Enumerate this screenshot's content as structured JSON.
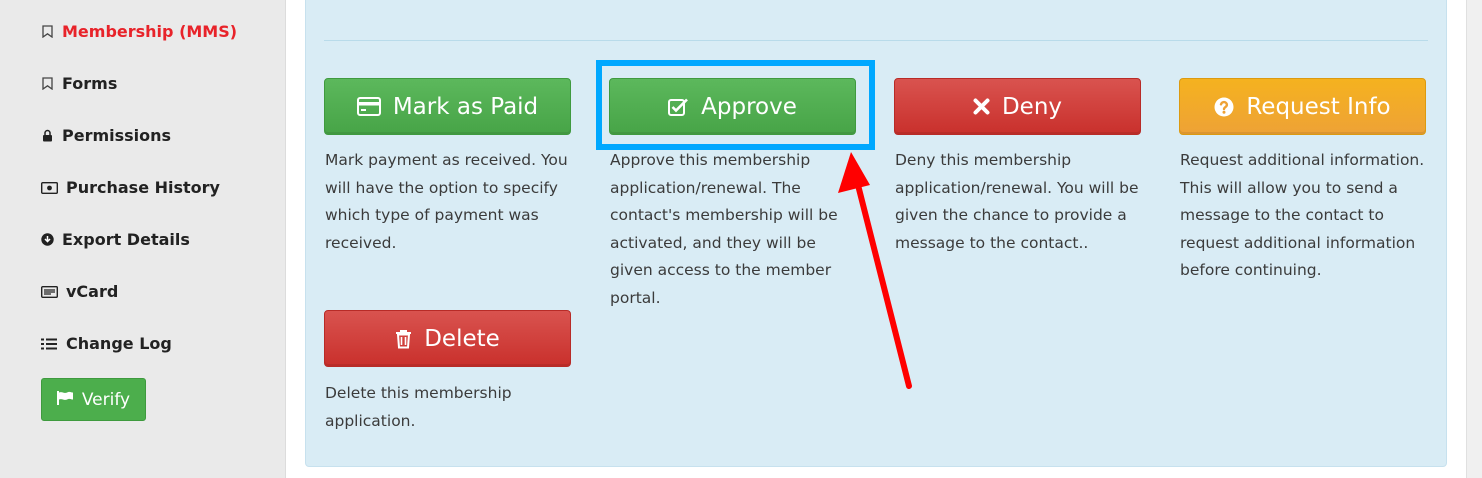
{
  "sidebar": {
    "items": [
      {
        "label": "Membership (MMS)",
        "icon": "bookmark-icon",
        "active": true
      },
      {
        "label": "Forms",
        "icon": "bookmark-icon",
        "active": false
      },
      {
        "label": "Permissions",
        "icon": "lock-icon",
        "active": false
      },
      {
        "label": "Purchase History",
        "icon": "money-icon",
        "active": false
      },
      {
        "label": "Export Details",
        "icon": "download-circle-icon",
        "active": false
      },
      {
        "label": "vCard",
        "icon": "card-icon",
        "active": false
      },
      {
        "label": "Change Log",
        "icon": "list-icon",
        "active": false
      }
    ],
    "verify_label": "Verify"
  },
  "actions": {
    "mark_paid": {
      "label": "Mark as Paid",
      "icon": "credit-card-icon",
      "description": "Mark payment as received. You will have the option to specify which type of payment was received."
    },
    "approve": {
      "label": "Approve",
      "icon": "check-square-icon",
      "description": "Approve this membership application/renewal. The contact's membership will be activated, and they will be given access to the member portal."
    },
    "deny": {
      "label": "Deny",
      "icon": "x-icon",
      "description": "Deny this membership application/renewal. You will be given the chance to provide a message to the contact.."
    },
    "request_info": {
      "label": "Request Info",
      "icon": "question-circle-icon",
      "description": "Request additional information. This will allow you to send a message to the contact to request additional information before continuing."
    },
    "delete": {
      "label": "Delete",
      "icon": "trash-icon",
      "description": "Delete this membership application."
    }
  },
  "colors": {
    "green": "#5cb85c",
    "red": "#d9534f",
    "orange": "#f0ad4e",
    "highlight": "#00a8ff",
    "arrow": "#ff0000",
    "active_nav": "#e8232a"
  }
}
